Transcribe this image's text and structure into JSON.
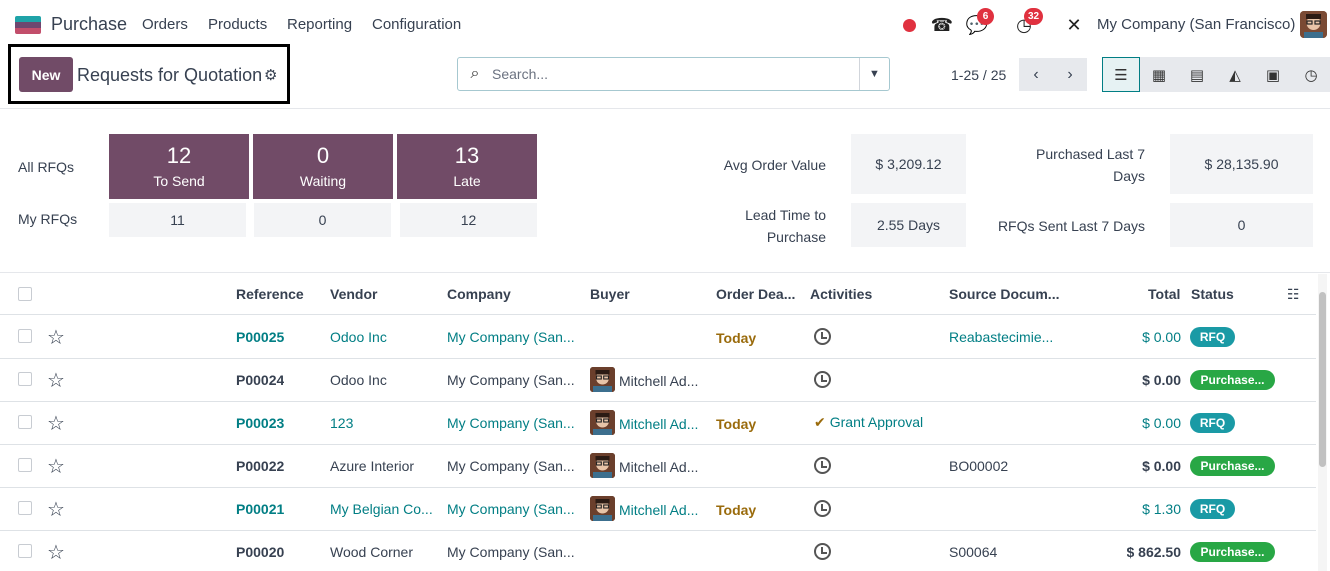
{
  "navbar": {
    "app_name": "Purchase",
    "menu": [
      "Orders",
      "Products",
      "Reporting",
      "Configuration"
    ],
    "messages_count": "6",
    "activities_count": "32",
    "company": "My Company (San Francisco)"
  },
  "control_panel": {
    "new_label": "New",
    "title": "Requests for Quotation",
    "search_placeholder": "Search...",
    "pager": "1-25 / 25"
  },
  "dashboard": {
    "all_rfqs_label": "All RFQs",
    "my_rfqs_label": "My RFQs",
    "tiles": [
      {
        "num": "12",
        "label": "To Send",
        "mine": "11"
      },
      {
        "num": "0",
        "label": "Waiting",
        "mine": "0"
      },
      {
        "num": "13",
        "label": "Late",
        "mine": "12"
      }
    ],
    "kpis": {
      "avg_order_label": "Avg Order Value",
      "avg_order_value": "$ 3,209.12",
      "purchased_label_1": "Purchased Last 7",
      "purchased_label_2": "Days",
      "purchased_value": "$ 28,135.90",
      "lead_label_1": "Lead Time to",
      "lead_label_2": "Purchase",
      "lead_value": "2.55 Days",
      "rfq_sent_label": "RFQs Sent Last 7 Days",
      "rfq_sent_value": "0"
    }
  },
  "table": {
    "headers": {
      "reference": "Reference",
      "vendor": "Vendor",
      "company": "Company",
      "buyer": "Buyer",
      "order_deadline": "Order Dea...",
      "activities": "Activities",
      "source": "Source Docum...",
      "total": "Total",
      "status": "Status"
    },
    "rows": [
      {
        "ref": "P00025",
        "vendor": "Odoo Inc",
        "company": "My Company (San...",
        "buyer": "",
        "deadline": "Today",
        "activity": "",
        "source": "Reabastecimie...",
        "total": "$ 0.00",
        "status": "RFQ"
      },
      {
        "ref": "P00024",
        "vendor": "Odoo Inc",
        "company": "My Company (San...",
        "buyer": "Mitchell Ad...",
        "deadline": "",
        "activity": "",
        "source": "",
        "total": "$ 0.00",
        "status": "Purchase..."
      },
      {
        "ref": "P00023",
        "vendor": "123",
        "company": "My Company (San...",
        "buyer": "Mitchell Ad...",
        "deadline": "Today",
        "activity": "Grant Approval",
        "source": "",
        "total": "$ 0.00",
        "status": "RFQ"
      },
      {
        "ref": "P00022",
        "vendor": "Azure Interior",
        "company": "My Company (San...",
        "buyer": "Mitchell Ad...",
        "deadline": "",
        "activity": "",
        "source": "BO00002",
        "total": "$ 0.00",
        "status": "Purchase..."
      },
      {
        "ref": "P00021",
        "vendor": "My Belgian Co...",
        "company": "My Company (San...",
        "buyer": "Mitchell Ad...",
        "deadline": "Today",
        "activity": "",
        "source": "",
        "total": "$ 1.30",
        "status": "RFQ"
      },
      {
        "ref": "P00020",
        "vendor": "Wood Corner",
        "company": "My Company (San...",
        "buyer": "",
        "deadline": "",
        "activity": "",
        "source": "S00064",
        "total": "$ 862.50",
        "status": "Purchase..."
      }
    ]
  },
  "colors": {
    "primary": "#714b67",
    "link": "#017e84",
    "rfq": "#1a9aa5",
    "purchase": "#28a745",
    "today": "#9a6b0c"
  }
}
